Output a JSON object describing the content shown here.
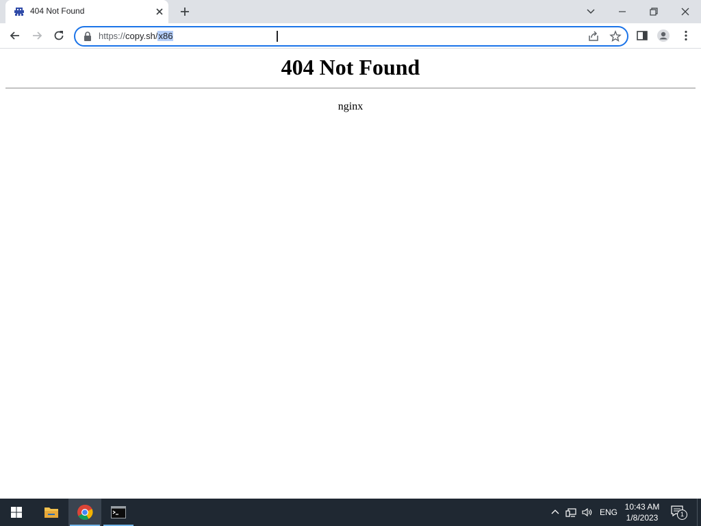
{
  "browser": {
    "tab": {
      "title": "404 Not Found"
    },
    "address_bar": {
      "url_prefix": "https://",
      "url_host": "copy.sh/",
      "url_selected": "x86"
    }
  },
  "page": {
    "heading": "404 Not Found",
    "server": "nginx"
  },
  "taskbar": {
    "language": "ENG",
    "time": "10:43 AM",
    "date": "1/8/2023",
    "notification_count": "1",
    "colors": {
      "background": "#1f2832",
      "active_item": "#3a4450",
      "accent": "#76b9ed"
    }
  },
  "icons": {
    "tab_favicon": "space-invader-icon",
    "tab_close": "close-icon",
    "new_tab": "plus-icon",
    "tab_search": "chevron-down-icon",
    "minimize": "minimize-icon",
    "restore": "restore-icon",
    "close_window": "close-icon",
    "back": "back-arrow-icon",
    "forward": "forward-arrow-icon",
    "reload": "reload-icon",
    "lock": "lock-icon",
    "share": "share-icon",
    "bookmark": "star-icon",
    "side_panel": "side-panel-icon",
    "profile": "profile-icon",
    "menu": "kebab-menu-icon",
    "start": "windows-logo-icon",
    "file_explorer": "folder-icon",
    "chrome": "chrome-icon",
    "terminal": "command-prompt-icon",
    "tray_overflow": "chevron-up-icon",
    "network": "network-icon",
    "volume": "speaker-icon",
    "action_center": "notification-icon"
  }
}
